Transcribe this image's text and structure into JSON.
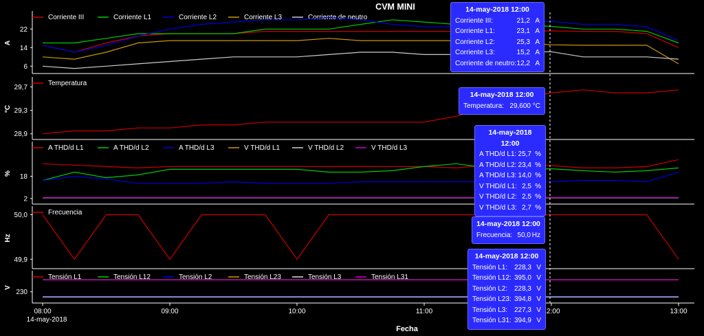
{
  "title": "CVM MINI",
  "xlabel": "Fecha",
  "date_label": "14-may-2018",
  "chart_data": [
    {
      "type": "line",
      "ylabel": "A",
      "yticks": [
        "6",
        "14",
        "22"
      ],
      "ylim": [
        4,
        28
      ],
      "grid": false,
      "legend": "top-left",
      "x": [
        "08:00",
        "08:15",
        "08:30",
        "08:45",
        "09:00",
        "09:15",
        "09:30",
        "09:45",
        "10:00",
        "10:15",
        "10:30",
        "10:45",
        "11:00",
        "11:15",
        "11:30",
        "11:45",
        "12:00",
        "12:15",
        "12:30",
        "12:45",
        "13:00"
      ],
      "series": [
        {
          "name": "Corriente III",
          "color": "#cc0000",
          "values": [
            15,
            12,
            16,
            19,
            20,
            20,
            20,
            21,
            21,
            21,
            21,
            21,
            21,
            21,
            21,
            21,
            21.2,
            21,
            21,
            20,
            14
          ]
        },
        {
          "name": "Corriente L1",
          "color": "#00cc00",
          "values": [
            16,
            16,
            18,
            20,
            20,
            20,
            20,
            22,
            22,
            22,
            24,
            26,
            25,
            24,
            24,
            24,
            23.1,
            22,
            22,
            21,
            16
          ]
        },
        {
          "name": "Corriente L2",
          "color": "#0000dd",
          "values": [
            15,
            12,
            15,
            19,
            22,
            24,
            25,
            26,
            26,
            27,
            26,
            24,
            23,
            23,
            24,
            25,
            25.3,
            24,
            24,
            23,
            17
          ]
        },
        {
          "name": "Corriente L3",
          "color": "#cc9900",
          "values": [
            10,
            9,
            12,
            16,
            17,
            17,
            17,
            17,
            17,
            18,
            17,
            17,
            17,
            17,
            16,
            16,
            15.2,
            15,
            15,
            15,
            7
          ]
        },
        {
          "name": "Corriente de neutro",
          "color": "#cccccc",
          "values": [
            6,
            5,
            6,
            7,
            8,
            9,
            10,
            10,
            10,
            11,
            12,
            12,
            11,
            11,
            12,
            12,
            12.2,
            10,
            10,
            10,
            9
          ]
        }
      ]
    },
    {
      "type": "line",
      "ylabel": "°C",
      "yticks": [
        "28,9",
        "29,3",
        "29,7"
      ],
      "ylim": [
        28.85,
        29.8
      ],
      "grid": false,
      "legend": "top-left",
      "x": [
        "08:00",
        "08:15",
        "08:30",
        "08:45",
        "09:00",
        "09:15",
        "09:30",
        "09:45",
        "10:00",
        "10:15",
        "10:30",
        "10:45",
        "11:00",
        "11:15",
        "11:30",
        "11:45",
        "12:00",
        "12:15",
        "12:30",
        "12:45",
        "13:00"
      ],
      "series": [
        {
          "name": "Temperatura",
          "color": "#cc0000",
          "values": [
            28.9,
            28.95,
            28.95,
            29.0,
            29.0,
            29.05,
            29.05,
            29.1,
            29.1,
            29.1,
            29.1,
            29.1,
            29.1,
            29.2,
            29.35,
            29.5,
            29.6,
            29.65,
            29.6,
            29.6,
            29.65
          ]
        }
      ]
    },
    {
      "type": "line",
      "ylabel": "%",
      "yticks": [
        "2",
        "18"
      ],
      "ylim": [
        0,
        40
      ],
      "grid": false,
      "legend": "top-left",
      "x": [
        "08:00",
        "08:15",
        "08:30",
        "08:45",
        "09:00",
        "09:15",
        "09:30",
        "09:45",
        "10:00",
        "10:15",
        "10:30",
        "10:45",
        "11:00",
        "11:15",
        "11:30",
        "11:45",
        "12:00",
        "12:15",
        "12:30",
        "12:45",
        "13:00"
      ],
      "series": [
        {
          "name": "A THD/d L1",
          "color": "#cc0000",
          "values": [
            27,
            26,
            25,
            24,
            25,
            25,
            25,
            25,
            25,
            25,
            25,
            25,
            25,
            24,
            26,
            26,
            25.7,
            24,
            24,
            25,
            30
          ]
        },
        {
          "name": "A THD/d L2",
          "color": "#00cc00",
          "values": [
            15,
            21,
            17,
            19,
            23,
            23,
            23,
            23,
            23,
            21,
            21,
            22,
            25,
            27,
            24,
            23,
            23.4,
            22,
            21,
            22,
            24
          ]
        },
        {
          "name": "A THD/d L3",
          "color": "#0000dd",
          "values": [
            15,
            18,
            16,
            13,
            13,
            13,
            14,
            13,
            13,
            13,
            14,
            14,
            14,
            14,
            14,
            14,
            14.0,
            15,
            15,
            14,
            21
          ]
        },
        {
          "name": "V THD/d L1",
          "color": "#cc9900",
          "values": [
            2.5,
            2.5,
            2.5,
            2.5,
            2.5,
            2.5,
            2.5,
            2.5,
            2.5,
            2.5,
            2.5,
            2.5,
            2.5,
            2.5,
            2.5,
            2.5,
            2.5,
            2.5,
            2.5,
            2.5,
            2.5
          ]
        },
        {
          "name": "V THD/d L2",
          "color": "#cccccc",
          "values": [
            2.5,
            2.5,
            2.5,
            2.5,
            2.5,
            2.5,
            2.5,
            2.5,
            2.5,
            2.5,
            2.5,
            2.5,
            2.5,
            2.5,
            2.5,
            2.5,
            2.5,
            2.5,
            2.5,
            2.5,
            2.5
          ]
        },
        {
          "name": "V THD/d L3",
          "color": "#cc00cc",
          "values": [
            2.7,
            2.7,
            2.7,
            2.7,
            2.7,
            2.7,
            2.7,
            2.7,
            2.7,
            2.7,
            2.7,
            2.7,
            2.7,
            2.7,
            2.7,
            2.7,
            2.7,
            2.7,
            2.7,
            2.7,
            2.7
          ]
        }
      ]
    },
    {
      "type": "line",
      "ylabel": "Hz",
      "yticks": [
        "49,9",
        "50,0"
      ],
      "ylim": [
        49.885,
        50.01
      ],
      "grid": false,
      "legend": "top-left",
      "x": [
        "08:00",
        "08:15",
        "08:30",
        "08:45",
        "09:00",
        "09:15",
        "09:30",
        "09:45",
        "10:00",
        "10:15",
        "10:30",
        "10:45",
        "11:00",
        "11:15",
        "11:30",
        "11:45",
        "12:00",
        "12:15",
        "12:30",
        "12:45",
        "13:00"
      ],
      "series": [
        {
          "name": "Frecuencia",
          "color": "#cc0000",
          "values": [
            50.0,
            49.9,
            50.0,
            50.0,
            49.9,
            50.0,
            50.0,
            50.0,
            49.9,
            50.0,
            50.0,
            50.0,
            50.0,
            50.0,
            50.0,
            50.0,
            50.0,
            50.0,
            50.0,
            50.0,
            49.9
          ]
        }
      ]
    },
    {
      "type": "line",
      "ylabel": "V",
      "yticks": [
        "230"
      ],
      "ylim": [
        225,
        240
      ],
      "grid": false,
      "legend": "top-left",
      "x": [
        "08:00",
        "08:15",
        "08:30",
        "08:45",
        "09:00",
        "09:15",
        "09:30",
        "09:45",
        "10:00",
        "10:15",
        "10:30",
        "10:45",
        "11:00",
        "11:15",
        "11:30",
        "11:45",
        "12:00",
        "12:15",
        "12:30",
        "12:45",
        "13:00"
      ],
      "series": [
        {
          "name": "Tensión L1",
          "color": "#cc0000",
          "values": [
            237,
            237,
            237,
            237,
            237,
            237,
            237,
            237,
            237,
            237,
            237,
            237,
            237,
            237,
            237,
            237,
            237,
            237,
            237,
            237,
            237
          ]
        },
        {
          "name": "Tensión L12",
          "color": "#00cc00",
          "values": [
            237,
            237,
            237,
            237,
            237,
            237,
            237,
            237,
            237,
            237,
            237,
            237,
            237,
            237,
            237,
            237,
            237,
            237,
            237,
            237,
            237
          ]
        },
        {
          "name": "Tensión L2",
          "color": "#0000dd",
          "values": [
            227.3,
            227.3,
            227.3,
            227.3,
            227.3,
            227.3,
            227.3,
            227.3,
            227.3,
            227.3,
            227.3,
            227.3,
            227.3,
            227.3,
            227.3,
            227.3,
            227.3,
            227.3,
            227.3,
            227.3,
            227.3
          ]
        },
        {
          "name": "Tensión L23",
          "color": "#cc9900",
          "values": [
            237,
            237,
            237,
            237,
            237,
            237,
            237,
            237,
            237,
            237,
            237,
            237,
            237,
            237,
            237,
            237,
            237,
            237,
            237,
            237,
            237
          ]
        },
        {
          "name": "Tensión L3",
          "color": "#dddddd",
          "values": [
            227,
            227,
            227,
            227,
            227,
            227,
            227,
            227,
            227,
            227,
            227,
            227,
            227,
            227,
            227,
            227,
            227,
            227,
            227,
            227,
            227
          ]
        },
        {
          "name": "Tensión L31",
          "color": "#cc00cc",
          "values": [
            237,
            237,
            237,
            237,
            237,
            237,
            237,
            237,
            237,
            237,
            237,
            237,
            237,
            237,
            237,
            237,
            237,
            237,
            237,
            237,
            237
          ]
        }
      ]
    }
  ],
  "x_axis_ticks": [
    "08:00",
    "09:00",
    "10:00",
    "11:00",
    "12:00",
    "13:00"
  ],
  "tooltips": [
    {
      "header": "14-may-2018 12:00",
      "rows": [
        {
          "label": "Corriente III:",
          "value": "21,2",
          "unit": "A"
        },
        {
          "label": "Corriente L1:",
          "value": "23,1",
          "unit": "A"
        },
        {
          "label": "Corriente L2:",
          "value": "25,3",
          "unit": "A"
        },
        {
          "label": "Corriente L3:",
          "value": "15,2",
          "unit": "A"
        },
        {
          "label": "Corriente de neutro:",
          "value": "12,2",
          "unit": "A"
        }
      ]
    },
    {
      "header": "14-may-2018 12:00",
      "rows": [
        {
          "label": "Temperatura:",
          "value": "29,600",
          "unit": "°C"
        }
      ]
    },
    {
      "header": "14-may-2018 12:00",
      "rows": [
        {
          "label": "A THD/d L1:",
          "value": "25,7",
          "unit": "%"
        },
        {
          "label": "A THD/d L2:",
          "value": "23,4",
          "unit": "%"
        },
        {
          "label": "A THD/d L3:",
          "value": "14,0",
          "unit": "%"
        },
        {
          "label": "V THD/d L1:",
          "value": "2,5",
          "unit": "%"
        },
        {
          "label": "V THD/d L2:",
          "value": "2,5",
          "unit": "%"
        },
        {
          "label": "V THD/d L3:",
          "value": "2,7",
          "unit": "%"
        }
      ]
    },
    {
      "header": "14-may-2018 12:00",
      "rows": [
        {
          "label": "Frecuencia:",
          "value": "50,0",
          "unit": "Hz"
        }
      ]
    },
    {
      "header": "14-may-2018 12:00",
      "rows": [
        {
          "label": "Tensión L1:",
          "value": "228,3",
          "unit": "V"
        },
        {
          "label": "Tensión L12:",
          "value": "395,0",
          "unit": "V"
        },
        {
          "label": "Tensión L2:",
          "value": "228,3",
          "unit": "V"
        },
        {
          "label": "Tensión L23:",
          "value": "394,8",
          "unit": "V"
        },
        {
          "label": "Tensión L3:",
          "value": "227,3",
          "unit": "V"
        },
        {
          "label": "Tensión L31:",
          "value": "394,9",
          "unit": "V"
        }
      ]
    }
  ]
}
